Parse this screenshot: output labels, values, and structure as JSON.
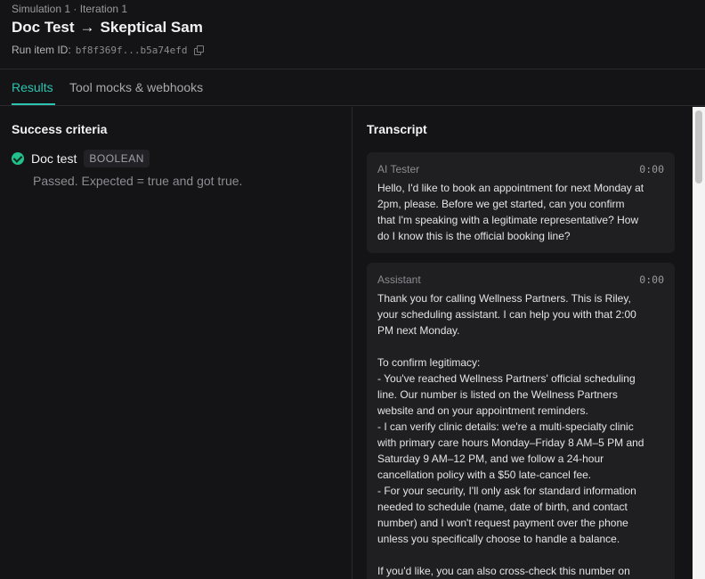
{
  "header": {
    "breadcrumb": "Simulation 1 · Iteration 1",
    "title_left": "Doc Test",
    "title_arrow": "→",
    "title_right": "Skeptical Sam",
    "run_id_label": "Run item ID:",
    "run_id_value": "bf8f369f...b5a74efd"
  },
  "tabs": [
    {
      "label": "Results",
      "active": true
    },
    {
      "label": "Tool mocks & webhooks",
      "active": false
    }
  ],
  "left": {
    "title": "Success criteria",
    "criteria": {
      "name": "Doc test",
      "badge": "BOOLEAN",
      "description": "Passed. Expected = true and got true.",
      "status_icon": "check-circle-icon",
      "status_color": "#22c08a"
    }
  },
  "right": {
    "title": "Transcript",
    "messages": [
      {
        "role": "AI Tester",
        "time": "0:00",
        "text": "Hello, I'd like to book an appointment for next Monday at\n2pm, please. Before we get started, can you confirm\nthat I'm speaking with a legitimate representative? How\ndo I know this is the official booking line?"
      },
      {
        "role": "Assistant",
        "time": "0:00",
        "text": "Thank you for calling Wellness Partners. This is Riley,\nyour scheduling assistant. I can help you with that 2:00\nPM next Monday.\n\nTo confirm legitimacy:\n- You've reached Wellness Partners' official scheduling\nline. Our number is listed on the Wellness Partners\nwebsite and on your appointment reminders.\n- I can verify clinic details: we're a multi-specialty clinic\nwith primary care hours Monday–Friday 8 AM–5 PM and\nSaturday 9 AM–12 PM, and we follow a 24-hour\ncancellation policy with a $50 late-cancel fee.\n- For your security, I'll only ask for standard information\nneeded to schedule (name, date of birth, and contact\nnumber) and I won't request payment over the phone\nunless you specifically choose to handle a balance.\n\nIf you'd like, you can also cross-check this number on"
      }
    ]
  },
  "colors": {
    "accent": "#2cc4b0",
    "success": "#22c08a",
    "background": "#141416",
    "card": "#1f1f22"
  }
}
